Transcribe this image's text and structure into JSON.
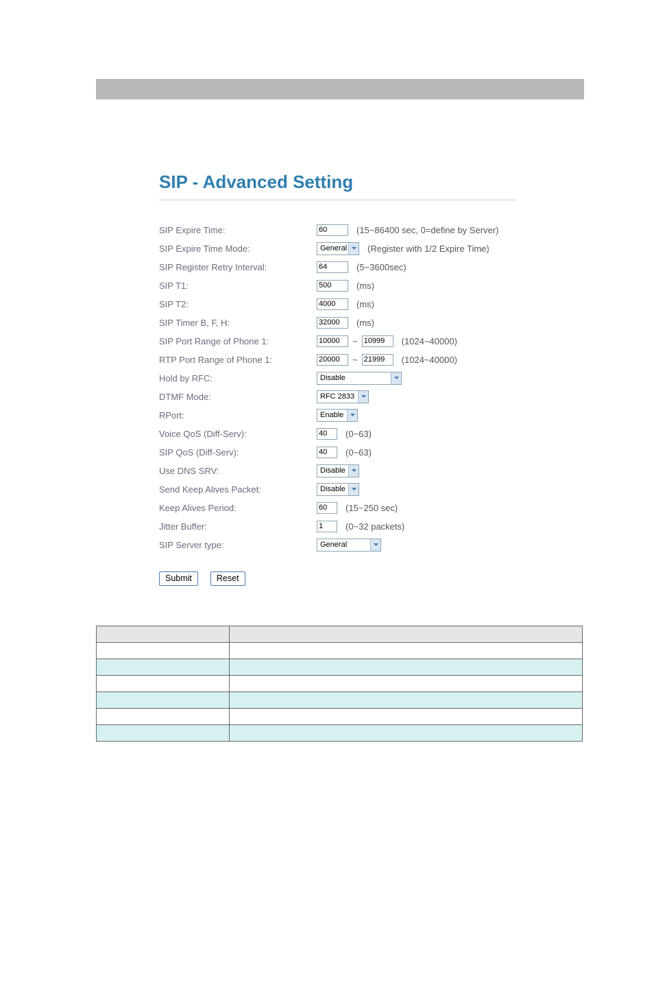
{
  "title": "SIP - Advanced Setting",
  "rows": {
    "sip_expire_time": {
      "label": "SIP Expire Time:",
      "value": "60",
      "after": "(15~86400 sec, 0=define by Server)"
    },
    "sip_expire_time_mode": {
      "label": "SIP Expire Time Mode:",
      "value": "General",
      "after": "(Register with 1/2 Expire Time)"
    },
    "sip_register_retry": {
      "label": "SIP Register Retry Interval:",
      "value": "64",
      "after": "(5~3600sec)"
    },
    "sip_t1": {
      "label": "SIP T1:",
      "value": "500",
      "after": "(ms)"
    },
    "sip_t2": {
      "label": "SIP T2:",
      "value": "4000",
      "after": "(ms)"
    },
    "sip_timer_bfh": {
      "label": "SIP Timer B, F, H:",
      "value": "32000",
      "after": "(ms)"
    },
    "sip_port_range": {
      "label": "SIP Port Range of Phone 1:",
      "from": "10000",
      "to": "10999",
      "after": "(1024~40000)"
    },
    "rtp_port_range": {
      "label": "RTP Port Range of Phone 1:",
      "from": "20000",
      "to": "21999",
      "after": "(1024~40000)"
    },
    "hold_by_rfc": {
      "label": "Hold by RFC:",
      "value": "Disable"
    },
    "dtmf_mode": {
      "label": "DTMF Mode:",
      "value": "RFC 2833"
    },
    "rport": {
      "label": "RPort:",
      "value": "Enable"
    },
    "voice_qos": {
      "label": "Voice QoS (Diff-Serv):",
      "value": "40",
      "after": "(0~63)"
    },
    "sip_qos": {
      "label": "SIP QoS (Diff-Serv):",
      "value": "40",
      "after": "(0~63)"
    },
    "use_dns_srv": {
      "label": "Use DNS SRV:",
      "value": "Disable"
    },
    "send_keepalive": {
      "label": "Send Keep Alives Packet:",
      "value": "Disable"
    },
    "keepalive_period": {
      "label": "Keep Alives Period:",
      "value": "60",
      "after": "(15~250 sec)"
    },
    "jitter_buffer": {
      "label": "Jitter Buffer:",
      "value": "1",
      "after": "(0~32 packets)"
    },
    "sip_server_type": {
      "label": "SIP Server type:",
      "value": "General"
    }
  },
  "buttons": {
    "submit": "Submit",
    "reset": "Reset"
  }
}
